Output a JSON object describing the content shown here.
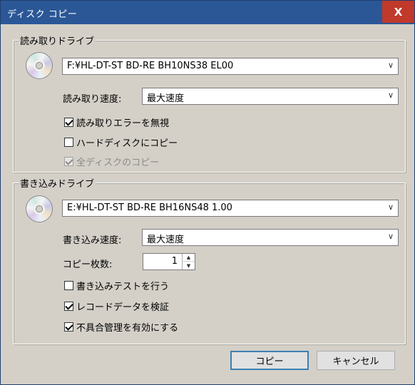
{
  "window": {
    "title": "ディスク コピー",
    "close_label": "X"
  },
  "read_group": {
    "label": "読み取りドライブ",
    "drive": "F:¥HL-DT-ST BD-RE BH10NS38 EL00",
    "speed_label": "読み取り速度:",
    "speed_value": "最大速度",
    "options": [
      {
        "label": "読み取りエラーを無視",
        "checked": true,
        "disabled": false
      },
      {
        "label": "ハードディスクにコピー",
        "checked": false,
        "disabled": false
      },
      {
        "label": "全ディスクのコピー",
        "checked": true,
        "disabled": true
      }
    ]
  },
  "write_group": {
    "label": "書き込みドライブ",
    "drive": "E:¥HL-DT-ST BD-RE BH16NS48 1.00",
    "speed_label": "書き込み速度:",
    "speed_value": "最大速度",
    "copies_label": "コピー枚数:",
    "copies_value": "1",
    "options": [
      {
        "label": "書き込みテストを行う",
        "checked": false,
        "disabled": false
      },
      {
        "label": "レコードデータを検証",
        "checked": true,
        "disabled": false
      },
      {
        "label": "不具合管理を有効にする",
        "checked": true,
        "disabled": false
      }
    ]
  },
  "buttons": {
    "copy": "コピー",
    "cancel": "キャンセル"
  },
  "icons": {
    "dropdown": "chevron-down-icon",
    "disc": "cd-disc-icon",
    "close": "close-icon"
  },
  "colors": {
    "titlebar": "#2b5797",
    "close": "#c0392b",
    "dialog_bg": "#d4d0c8"
  }
}
